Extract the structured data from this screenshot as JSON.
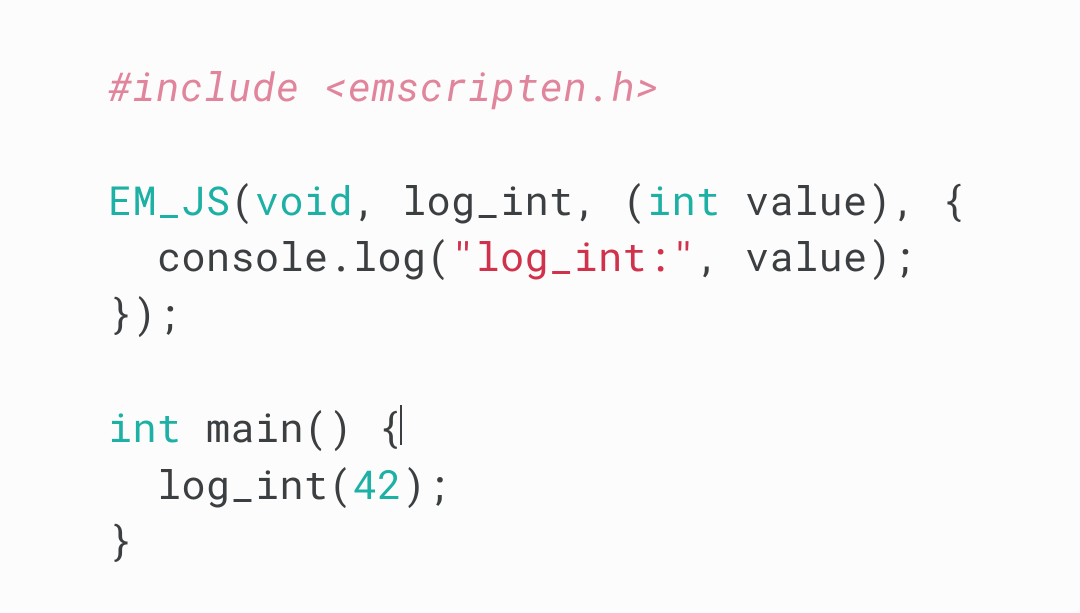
{
  "code": {
    "include_directive": "#include <emscripten.h>",
    "emjs_name": "EM_JS",
    "l2_a": "(",
    "l2_void": "void",
    "l2_b": ", log_int, (",
    "l2_int": "int",
    "l2_c": " value), {",
    "l3_a": "  console.log(",
    "l3_str": "\"log_int:\"",
    "l3_b": ", value);",
    "l4": "});",
    "l6_int": "int",
    "l6_a": " main() {",
    "l7_a": "  log_int(",
    "l7_num": "42",
    "l7_b": ");",
    "l8": "}"
  }
}
